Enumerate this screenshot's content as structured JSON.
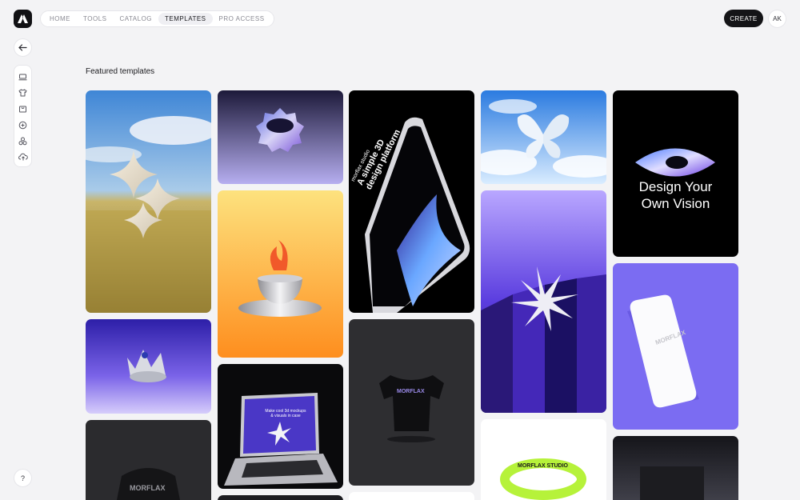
{
  "header": {
    "logo_icon": "morflax-logo-icon",
    "nav": [
      "HOME",
      "TOOLS",
      "CATALOG",
      "TEMPLATES",
      "PRO ACCESS"
    ],
    "active_nav": "TEMPLATES",
    "create_label": "CREATE",
    "avatar_initials": "AK"
  },
  "sidebar": {
    "back_icon": "arrow-left-icon",
    "tools": [
      "laptop-icon",
      "tshirt-icon",
      "bag-icon",
      "badge-icon",
      "shapes-icon",
      "upload-cloud-icon"
    ],
    "help_label": "?"
  },
  "main": {
    "title": "Featured templates"
  },
  "templates": {
    "phone_poster": {
      "brand": "morflax studio",
      "line1": "A simple 3D",
      "line2": "design platform"
    },
    "eye_poster": {
      "line1": "Design Your",
      "line2": "Own Vision"
    },
    "iphone_brand": "MORFLAX",
    "laptop_screen": {
      "line1": "Make cool 3d mockups",
      "line2": "& visuals in case"
    },
    "wristband_text": "MORFLAX STUDIO"
  },
  "colors": {
    "accent_dark": "#141417",
    "background": "#f3f3f5",
    "card_purple": "#7a6cf0",
    "card_orange": "#fda431"
  }
}
